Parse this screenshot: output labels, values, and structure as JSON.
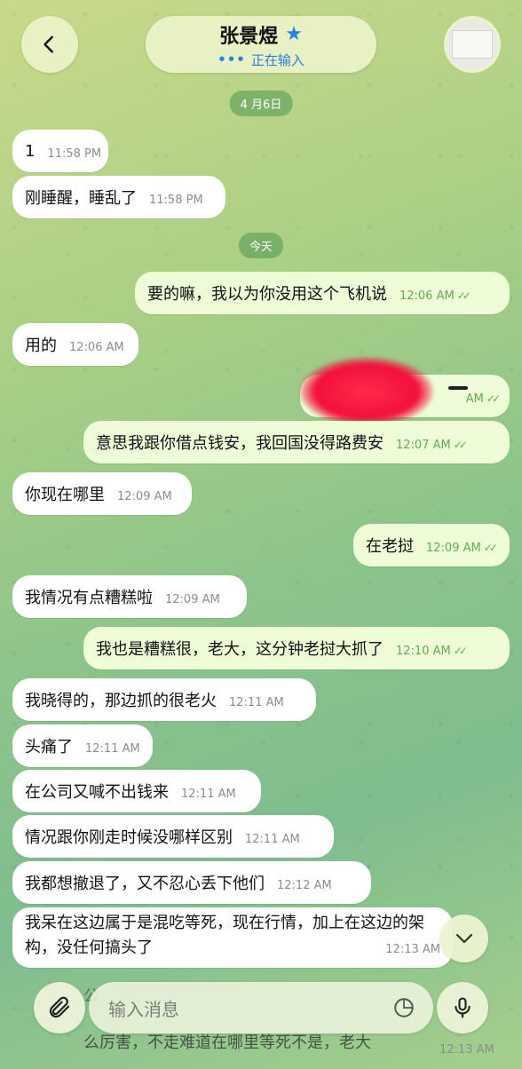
{
  "header": {
    "name": "张景煜",
    "status": "正在输入",
    "typing_dots": "•••",
    "star_icon": "star-icon",
    "back_icon": "chevron-left-icon"
  },
  "date_chips": [
    "4 月6日",
    "今天"
  ],
  "messages": [
    {
      "dir": "in",
      "text": "1",
      "time": "11:58 PM"
    },
    {
      "dir": "in",
      "text": "刚睡醒，睡乱了",
      "time": "11:58 PM"
    },
    {
      "dir": "out",
      "text": "要的嘛，我以为你没用这个飞机说",
      "time": "12:06 AM"
    },
    {
      "dir": "in",
      "text": "用的",
      "time": "12:06 AM"
    },
    {
      "dir": "out",
      "text": "",
      "time": "AM",
      "redacted": true
    },
    {
      "dir": "out",
      "text": "意思我跟你借点钱安，我回国没得路费安",
      "time": "12:07 AM"
    },
    {
      "dir": "in",
      "text": "你现在哪里",
      "time": "12:09 AM"
    },
    {
      "dir": "out",
      "text": "在老挝",
      "time": "12:09 AM"
    },
    {
      "dir": "in",
      "text": "我情况有点糟糕啦",
      "time": "12:09 AM"
    },
    {
      "dir": "out",
      "text": "我也是糟糕很，老大，这分钟老挝大抓了",
      "time": "12:10 AM"
    },
    {
      "dir": "in",
      "text": "我晓得的，那边抓的很老火",
      "time": "12:11 AM"
    },
    {
      "dir": "in",
      "text": "头痛了",
      "time": "12:11 AM"
    },
    {
      "dir": "in",
      "text": "在公司又喊不出钱来",
      "time": "12:11 AM"
    },
    {
      "dir": "in",
      "text": "情况跟你刚走时候没哪样区别",
      "time": "12:11 AM"
    },
    {
      "dir": "in",
      "text": "我都想撤退了，又不忍心丢下他们",
      "time": "12:12 AM"
    },
    {
      "dir": "in",
      "text": "我呆在这边属于是混吃等死，现在行情，加上在这边的架构，没任何搞头了",
      "time": "12:13 AM"
    }
  ],
  "partial_message": {
    "line_top": "公",
    "line_bottom": "么厉害，不走难道在哪里等死不是，老大",
    "time": "12:13 AM"
  },
  "composer": {
    "placeholder": "输入消息"
  }
}
